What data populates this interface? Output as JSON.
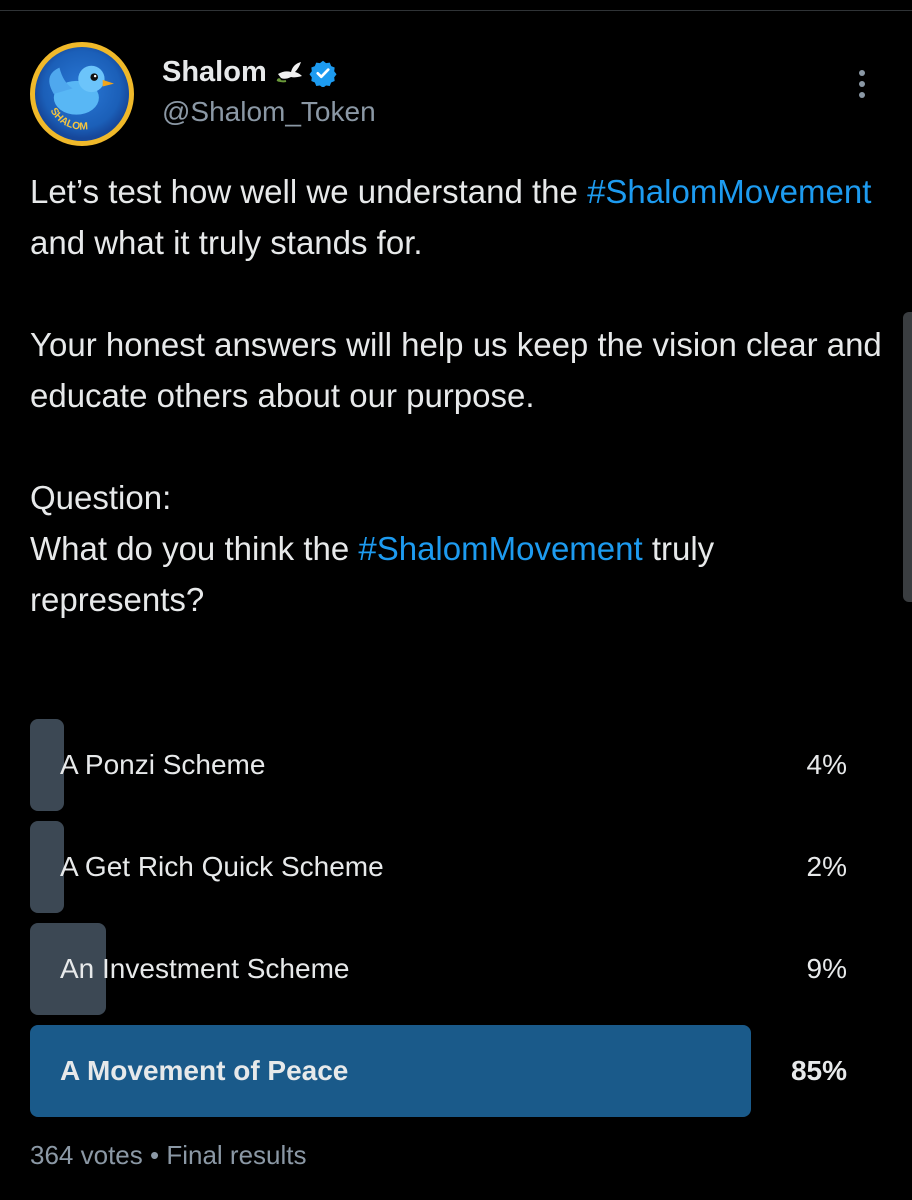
{
  "author": {
    "name": "Shalom",
    "handle": "@Shalom_Token",
    "avatar_text": "SHALOM",
    "dove_icon": "dove-with-olive-branch-icon",
    "verified_icon": "verified-badge-icon",
    "verified_color": "#1d9bf0"
  },
  "post": {
    "p1_before": "Let’s test how well we understand the ",
    "p1_hashtag": "#ShalomMovement",
    "p1_after": " and what it truly stands for.",
    "p2": "Your honest answers will help us keep the vision clear and educate others about our purpose.",
    "question_heading": "Question:",
    "q_before": "What do you think the ",
    "q_hashtag": "#ShalomMovement",
    "q_after": " truly represents?"
  },
  "poll": {
    "options": [
      {
        "label": "A Ponzi Scheme",
        "percent_text": "4%",
        "fraction": 0.04
      },
      {
        "label": "A Get Rich Quick Scheme",
        "percent_text": "2%",
        "fraction": 0.02
      },
      {
        "label": "An Investment Scheme",
        "percent_text": "9%",
        "fraction": 0.09
      },
      {
        "label": "A Movement of Peace",
        "percent_text": "85%",
        "fraction": 0.85,
        "winner": true
      }
    ],
    "votes": "364 votes",
    "separator": "•",
    "status": "Final results"
  },
  "colors": {
    "background": "#000000",
    "accent": "#1d9bf0",
    "bar": "#3c4854",
    "winner_bar": "#1a5a8a"
  }
}
